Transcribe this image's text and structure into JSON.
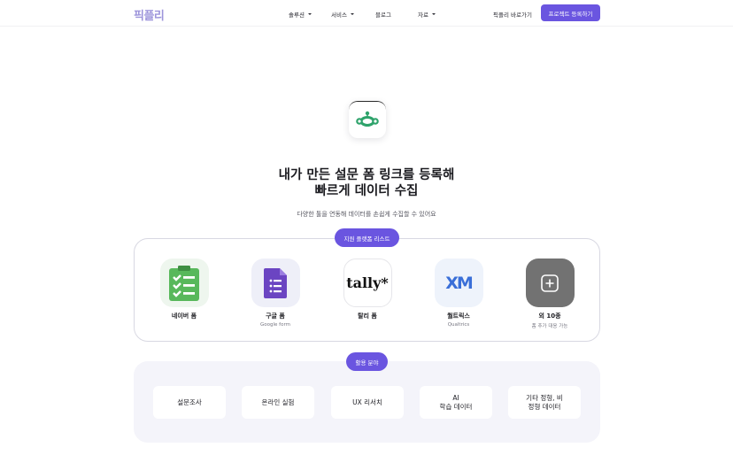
{
  "nav": {
    "logo": "픽플리",
    "links": [
      {
        "label": "솔루션",
        "has_caret": true
      },
      {
        "label": "서비스",
        "has_caret": true
      },
      {
        "label": "블로그",
        "has_caret": false
      },
      {
        "label": "자료",
        "has_caret": true
      }
    ],
    "shortcut": "픽플리 바로가기",
    "cta": "프로젝트 등록하기"
  },
  "hero": {
    "icon": "surveymonkey-logo-icon",
    "title_line1": "내가 만든 설문 폼 링크를 등록해",
    "title_line2": "빠르게 데이터 수집",
    "subtitle": "다양한 툴을 연동해 데이터를 손쉽게 수집할 수 있어요"
  },
  "platforms": {
    "badge": "지원 플랫폼 리스트",
    "items": [
      {
        "name": "네이버 폼",
        "sub": "",
        "icon": "naver-form-checklist-icon"
      },
      {
        "name": "구글 폼",
        "sub": "Google form",
        "icon": "google-form-icon"
      },
      {
        "name": "탈리 폼",
        "sub": "",
        "icon": "tally-logo-icon",
        "logo_text": "tally*"
      },
      {
        "name": "퀄트릭스",
        "sub": "Qualtrics",
        "icon": "qualtrics-xm-icon",
        "logo_text": "XM"
      },
      {
        "name": "외 10종",
        "sub": "폼 추가 대응 가능",
        "icon": "plus-square-icon"
      }
    ]
  },
  "usage": {
    "badge": "활용 분야",
    "items": [
      "설문조사",
      "온라인 실험",
      "UX 리서치",
      "AI\n학습 데이터",
      "기타 정형, 비\n정형 데이터"
    ]
  },
  "colors": {
    "accent": "#6a55e0",
    "logo": "#9d95db",
    "naver_green": "#58b85b",
    "google_purple": "#6b45c2",
    "tally_black": "#111111",
    "plus_tile": "#727272"
  }
}
